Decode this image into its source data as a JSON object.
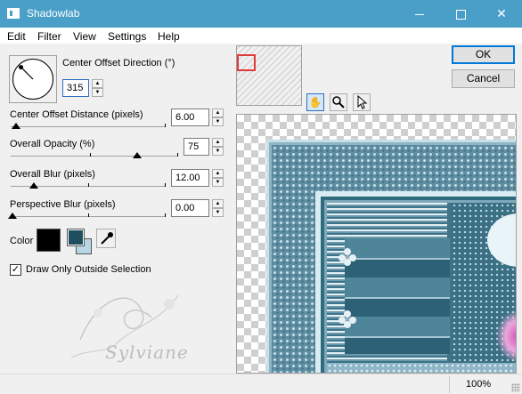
{
  "window": {
    "title": "Shadowlab",
    "icon": "window-app-icon",
    "controls": [
      "minimize-icon",
      "maximize-icon",
      "close-icon"
    ],
    "close_glyph": "✕"
  },
  "menu": {
    "items": [
      "Edit",
      "Filter",
      "View",
      "Settings",
      "Help"
    ]
  },
  "direction": {
    "label": "Center Offset Direction (°)",
    "value": "315",
    "dial_angle_degrees": 315
  },
  "distance": {
    "label": "Center Offset Distance (pixels)",
    "value": "6.00"
  },
  "opacity": {
    "label": "Overall Opacity (%)",
    "value": "75"
  },
  "blur": {
    "label": "Overall Blur (pixels)",
    "value": "12.00"
  },
  "perspective": {
    "label": "Perspective Blur (pixels)",
    "value": "0.00"
  },
  "color": {
    "label": "Color",
    "shadow_color": "#000000",
    "foreground": "#1f4f5e",
    "background": "#b8d6e6",
    "eyedropper_icon": "eyedropper-icon"
  },
  "options": {
    "outside_selection_label": "Draw Only Outside Selection",
    "outside_selection_checked": true,
    "check_glyph": "✓"
  },
  "tools": {
    "pan": "hand-pan-icon",
    "zoom": "magnifier-icon",
    "pointer": "arrow-pointer-icon"
  },
  "buttons": {
    "ok": "OK",
    "cancel": "Cancel"
  },
  "watermark": {
    "signature": "Sylviane"
  },
  "status": {
    "zoom": "100%"
  },
  "colors": {
    "titlebar": "#4a9fc9",
    "thumb_rect": "#e13a3a",
    "accent": "#0078d7"
  }
}
